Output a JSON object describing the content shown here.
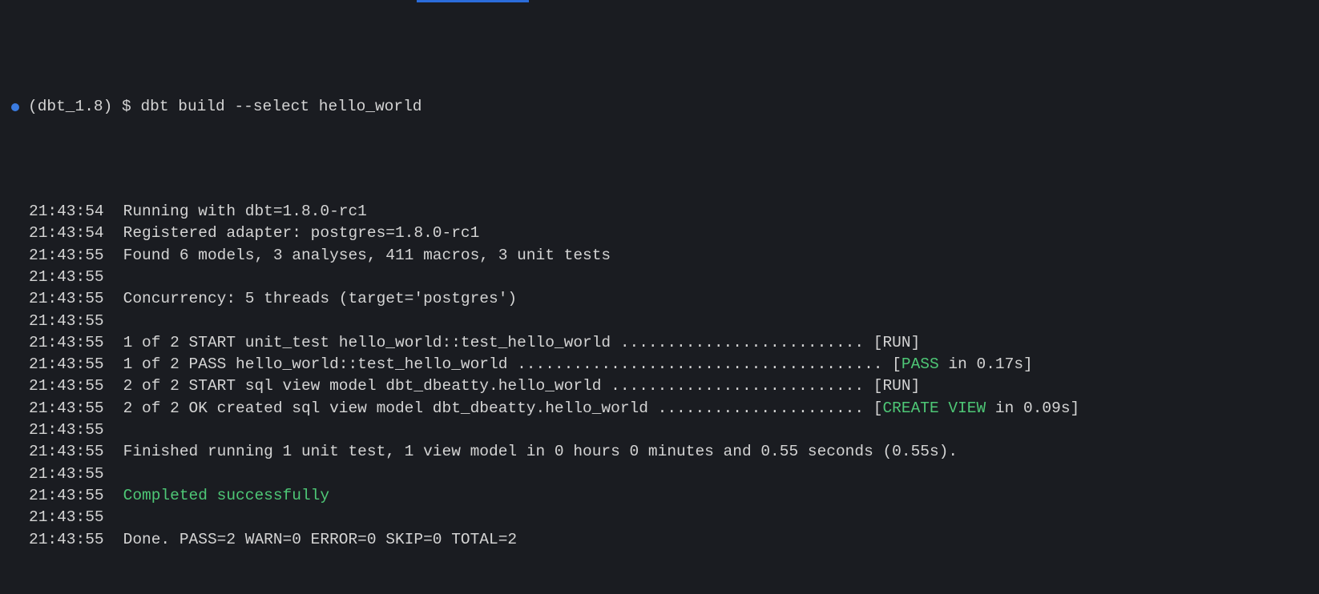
{
  "top_accent_visible": true,
  "prompt": {
    "env": "(dbt_1.8)",
    "symbol": "$",
    "command": "dbt build --select hello_world"
  },
  "lines": [
    {
      "ts": "21:43:54",
      "segments": [
        {
          "text": "Running with dbt=1.8.0-rc1",
          "cls": "msg"
        }
      ]
    },
    {
      "ts": "21:43:54",
      "segments": [
        {
          "text": "Registered adapter: postgres=1.8.0-rc1",
          "cls": "msg"
        }
      ]
    },
    {
      "ts": "21:43:55",
      "segments": [
        {
          "text": "Found 6 models, 3 analyses, 411 macros, 3 unit tests",
          "cls": "msg"
        }
      ]
    },
    {
      "ts": "21:43:55",
      "segments": [
        {
          "text": "",
          "cls": "msg"
        }
      ]
    },
    {
      "ts": "21:43:55",
      "segments": [
        {
          "text": "Concurrency: 5 threads (target='postgres')",
          "cls": "msg"
        }
      ]
    },
    {
      "ts": "21:43:55",
      "segments": [
        {
          "text": "",
          "cls": "msg"
        }
      ]
    },
    {
      "ts": "21:43:55",
      "segments": [
        {
          "text": "1 of 2 START unit_test hello_world::test_hello_world .......................... [",
          "cls": "msg"
        },
        {
          "text": "RUN",
          "cls": "msg"
        },
        {
          "text": "]",
          "cls": "msg"
        }
      ]
    },
    {
      "ts": "21:43:55",
      "segments": [
        {
          "text": "1 of 2 PASS hello_world::test_hello_world ....................................... [",
          "cls": "msg"
        },
        {
          "text": "PASS",
          "cls": "green"
        },
        {
          "text": " in 0.17s]",
          "cls": "msg"
        }
      ]
    },
    {
      "ts": "21:43:55",
      "segments": [
        {
          "text": "2 of 2 START sql view model dbt_dbeatty.hello_world ........................... [",
          "cls": "msg"
        },
        {
          "text": "RUN",
          "cls": "msg"
        },
        {
          "text": "]",
          "cls": "msg"
        }
      ]
    },
    {
      "ts": "21:43:55",
      "segments": [
        {
          "text": "2 of 2 OK created sql view model dbt_dbeatty.hello_world ...................... [",
          "cls": "msg"
        },
        {
          "text": "CREATE VIEW",
          "cls": "green"
        },
        {
          "text": " in 0.09s]",
          "cls": "msg"
        }
      ]
    },
    {
      "ts": "21:43:55",
      "segments": [
        {
          "text": "",
          "cls": "msg"
        }
      ]
    },
    {
      "ts": "21:43:55",
      "segments": [
        {
          "text": "Finished running 1 unit test, 1 view model in 0 hours 0 minutes and 0.55 seconds (0.55s).",
          "cls": "msg"
        }
      ]
    },
    {
      "ts": "21:43:55",
      "segments": [
        {
          "text": "",
          "cls": "msg"
        }
      ]
    },
    {
      "ts": "21:43:55",
      "segments": [
        {
          "text": "Completed successfully",
          "cls": "green"
        }
      ]
    },
    {
      "ts": "21:43:55",
      "segments": [
        {
          "text": "",
          "cls": "msg"
        }
      ]
    },
    {
      "ts": "21:43:55",
      "segments": [
        {
          "text": "Done. PASS=2 WARN=0 ERROR=0 SKIP=0 TOTAL=2",
          "cls": "msg"
        }
      ]
    }
  ]
}
